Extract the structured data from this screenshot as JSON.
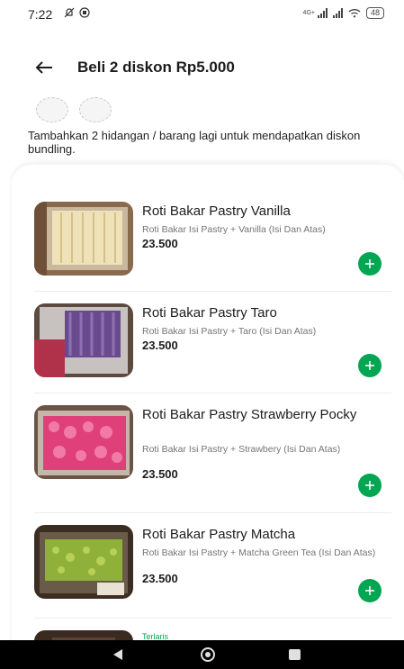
{
  "status_bar": {
    "time": "7:22",
    "network_label": "4G+",
    "battery": "48"
  },
  "header": {
    "title": "Beli 2 diskon Rp5.000"
  },
  "bundle": {
    "note": "Tambahkan 2 hidangan / barang lagi untuk mendapatkan diskon bundling.",
    "slots_filled": 0,
    "slots_total": 2
  },
  "items": [
    {
      "name": "Roti Bakar Pastry Vanilla",
      "description": "Roti Bakar Isi Pastry + Vanilla (Isi Dan Atas)",
      "price": "23.500"
    },
    {
      "name": "Roti Bakar Pastry Taro",
      "description": "Roti Bakar Isi Pastry + Taro (Isi Dan Atas)",
      "price": "23.500"
    },
    {
      "name": "Roti Bakar Pastry Strawberry Pocky",
      "description": "Roti Bakar Isi Pastry + Strawbery (Isi Dan Atas)",
      "price": "23.500"
    },
    {
      "name": "Roti Bakar Pastry Matcha",
      "description": "Roti Bakar Isi Pastry + Matcha Green Tea (Isi Dan Atas)",
      "price": "23.500"
    }
  ],
  "next_item": {
    "badge": "Terlaris"
  },
  "icons": {
    "back": "arrow-left-icon",
    "add": "plus-icon",
    "nav_back": "triangle-back-icon",
    "nav_home": "circle-home-icon",
    "nav_recent": "square-recent-icon"
  },
  "colors": {
    "accent": "#00a651",
    "nav_bar": "#000000"
  }
}
